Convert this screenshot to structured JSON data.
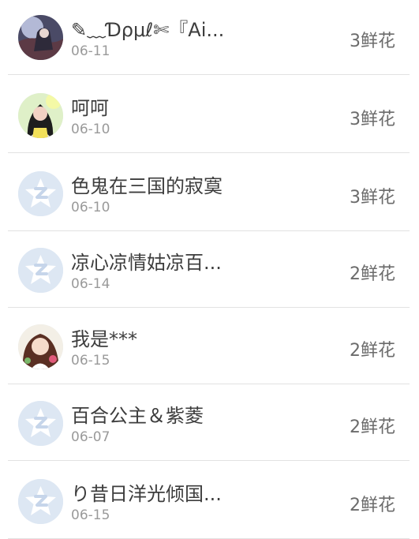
{
  "list": {
    "items": [
      {
        "name": "✎﹏Ɗρμℓ✄『Ai...",
        "date": "06-11",
        "flowers": "3鲜花",
        "avatar_icon": "photo-avatar-dark-scene"
      },
      {
        "name": "呵呵",
        "date": "06-10",
        "flowers": "3鲜花",
        "avatar_icon": "photo-avatar-girl"
      },
      {
        "name": "色鬼在三国的寂寞",
        "date": "06-10",
        "flowers": "3鲜花",
        "avatar_icon": "default-star-avatar"
      },
      {
        "name": "凉心凉情姑凉百...",
        "date": "06-14",
        "flowers": "2鲜花",
        "avatar_icon": "default-star-avatar"
      },
      {
        "name": "我是***",
        "date": "06-15",
        "flowers": "2鲜花",
        "avatar_icon": "anime-avatar"
      },
      {
        "name": "百合公主＆紫菱",
        "date": "06-07",
        "flowers": "2鲜花",
        "avatar_icon": "default-star-avatar"
      },
      {
        "name": "り昔日洋光倾国...",
        "date": "06-15",
        "flowers": "2鲜花",
        "avatar_icon": "default-star-avatar"
      }
    ]
  },
  "colors": {
    "name_text": "#3d3d3d",
    "date_text": "#9a9a9a",
    "flowers_text": "#6b6b6b",
    "divider": "#e2e2e2",
    "default_avatar_bg": "#dde7f3"
  }
}
